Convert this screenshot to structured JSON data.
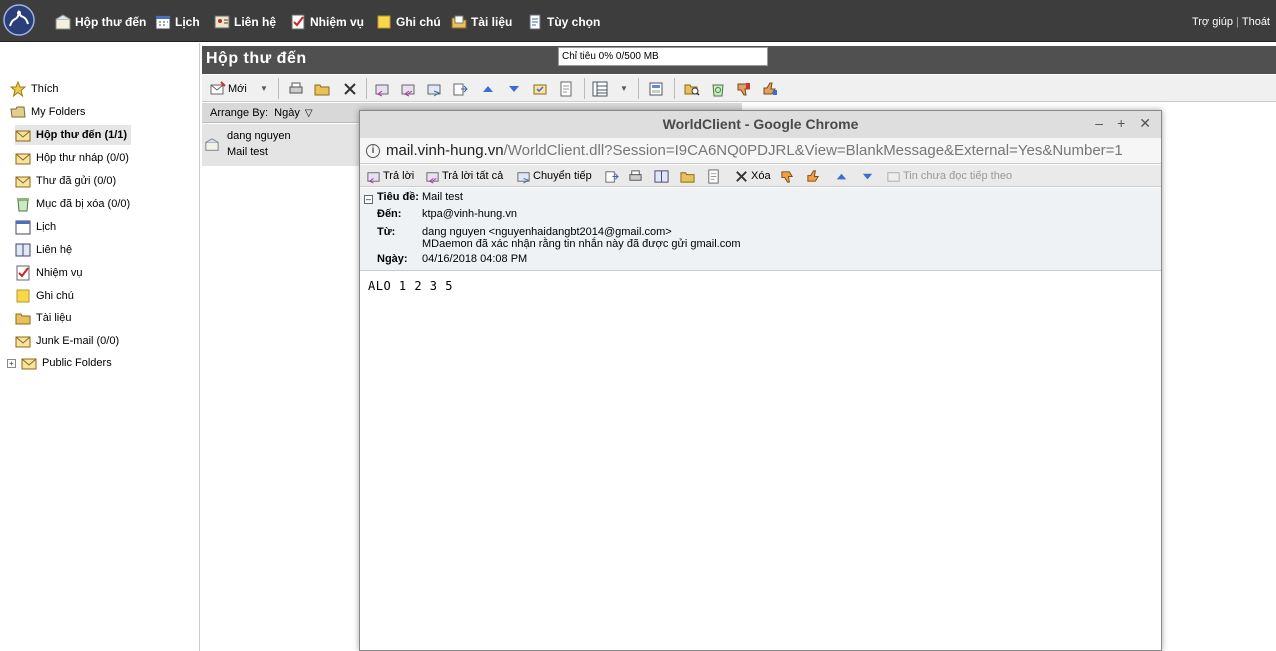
{
  "nav": {
    "items": [
      {
        "label": "Hộp thư đến",
        "icon": "inbox-icon"
      },
      {
        "label": "Lịch",
        "icon": "calendar-icon"
      },
      {
        "label": "Liên hệ",
        "icon": "contacts-icon"
      },
      {
        "label": "Nhiệm vụ",
        "icon": "tasks-icon"
      },
      {
        "label": "Ghi chú",
        "icon": "notes-icon"
      },
      {
        "label": "Tài liệu",
        "icon": "documents-icon"
      },
      {
        "label": "Tùy chọn",
        "icon": "options-icon"
      }
    ],
    "help": "Trợ giúp",
    "logout": "Thoát"
  },
  "sidebar": {
    "items": [
      {
        "label": "Thích",
        "icon": "star-icon"
      },
      {
        "label": "My Folders",
        "icon": "folders-icon"
      },
      {
        "label": "Hộp thư đến (1/1)",
        "icon": "inbox-folder-icon"
      },
      {
        "label": "Hộp thư nháp (0/0)",
        "icon": "drafts-icon"
      },
      {
        "label": "Thư đã gửi (0/0)",
        "icon": "sent-icon"
      },
      {
        "label": "Mục đã bị xóa (0/0)",
        "icon": "trash-icon"
      },
      {
        "label": "Lịch",
        "icon": "calendar-icon"
      },
      {
        "label": "Liên hệ",
        "icon": "contacts-icon"
      },
      {
        "label": "Nhiệm vụ",
        "icon": "tasks-icon"
      },
      {
        "label": "Ghi chú",
        "icon": "notes-icon"
      },
      {
        "label": "Tài liệu",
        "icon": "documents-icon"
      },
      {
        "label": "Junk E-mail (0/0)",
        "icon": "junk-icon"
      },
      {
        "label": "Public Folders",
        "icon": "public-folders-icon",
        "expander": "+"
      }
    ]
  },
  "main": {
    "title": "Hộp thư đến",
    "quota": "Chỉ tiêu 0% 0/500 MB",
    "new_label": "Mới",
    "arrange_label": "Arrange By:",
    "arrange_value": "Ngày",
    "message": {
      "from": "dang nguyen",
      "subject": "Mail test"
    }
  },
  "popup": {
    "window_title": "WorldClient - Google Chrome",
    "url_host": "mail.vinh-hung.vn",
    "url_path": "/WorldClient.dll?Session=I9CA6NQ0PDJRL&View=BlankMessage&External=Yes&Number=1",
    "toolbar": {
      "reply": "Trả lời",
      "reply_all": "Trả lời tất cả",
      "forward": "Chuyển tiếp",
      "delete": "Xóa",
      "next_unread": "Tin chưa đọc tiếp theo"
    },
    "headers": {
      "subject_label": "Tiêu đề:",
      "subject": "Mail test",
      "to_label": "Đến:",
      "to": "ktpa@vinh-hung.vn",
      "from_label": "Từ:",
      "from": "dang nguyen <nguyenhaidangbt2014@gmail.com>",
      "receipt": "MDaemon đã xác nhận rằng tin nhắn này đã được gửi gmail.com",
      "date_label": "Ngày:",
      "date": "04/16/2018 04:08 PM"
    },
    "body": "ALO 1 2 3 5"
  },
  "colors": {
    "topbar": "#3d3d3d",
    "header_bar": "#505050",
    "selected": "#e6e6e6"
  }
}
